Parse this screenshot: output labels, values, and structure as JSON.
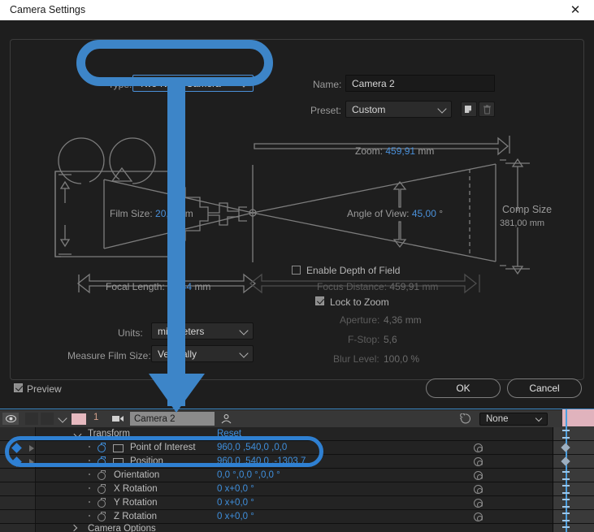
{
  "window": {
    "title": "Camera Settings",
    "close_icon": "close-icon"
  },
  "camera_settings": {
    "type_label": "Type:",
    "type_value": "Two-Node Camera",
    "name_label": "Name:",
    "name_value": "Camera 2",
    "preset_label": "Preset:",
    "preset_value": "Custom",
    "save_preset_icon": "save-preset-icon",
    "delete_preset_icon": "trash-icon",
    "diagram": {
      "zoom_label": "Zoom:",
      "zoom_value": "459,91",
      "zoom_unit": "mm",
      "film_size_label": "Film Size:",
      "film_size_value": "20,2",
      "film_size_unit": "mm",
      "angle_of_view_label": "Angle of View:",
      "angle_of_view_value": "45,00",
      "angle_of_view_unit": "°",
      "comp_size_label": "Comp Size",
      "comp_size_value": "381,00 mm",
      "focal_length_label": "Focal Length:",
      "focal_length_value": "24,44",
      "focal_length_unit": "mm",
      "focus_distance_label": "Focus Distance:",
      "focus_distance_value": "459,91",
      "focus_distance_unit": "mm"
    },
    "enable_dof_label": "Enable Depth of Field",
    "enable_dof_checked": false,
    "lock_to_zoom_label": "Lock to Zoom",
    "lock_to_zoom_checked": true,
    "aperture_label": "Aperture:",
    "aperture_value": "4,36 mm",
    "fstop_label": "F-Stop:",
    "fstop_value": "5,6",
    "blur_level_label": "Blur Level:",
    "blur_level_value": "100,0 %",
    "units_label": "Units:",
    "units_value": "millimeters",
    "measure_film_size_label": "Measure Film Size:",
    "measure_film_size_value": "Vertically",
    "preview_label": "Preview",
    "preview_checked": true,
    "ok_label": "OK",
    "cancel_label": "Cancel"
  },
  "timeline": {
    "header": {
      "eye_icon": "eye-icon",
      "layer_number": "1",
      "layer_type_icon": "camera-icon",
      "layer_name": "Camera 2",
      "parent_icon": "parent-link-icon",
      "parent_value": "None"
    },
    "groups": [
      {
        "label": "Transform",
        "reset": "Reset",
        "expanded": true
      },
      {
        "label": "Camera Options",
        "expanded": false
      }
    ],
    "properties": [
      {
        "name": "Point of Interest",
        "value": "960,0 ,540,0 ,0,0",
        "animated": true,
        "highlighted": true
      },
      {
        "name": "Position",
        "value": "960,0 ,540,0 ,-1303,7",
        "animated": true,
        "highlighted": true
      },
      {
        "name": "Orientation",
        "value": "0,0 °,0,0 °,0,0 °",
        "animated": false,
        "highlighted": false
      },
      {
        "name": "X Rotation",
        "value": "0 x+0,0 °",
        "animated": false,
        "highlighted": false
      },
      {
        "name": "Y Rotation",
        "value": "0 x+0,0 °",
        "animated": false,
        "highlighted": false
      },
      {
        "name": "Z Rotation",
        "value": "0 x+0,0 °",
        "animated": false,
        "highlighted": false
      }
    ]
  },
  "annotations": {
    "type_highlight": "rounded-rectangle-highlight",
    "keyframe_rows_highlight": "rounded-rectangle-highlight",
    "arrow": "down-arrow-annotation",
    "color": "#3d85c8"
  }
}
